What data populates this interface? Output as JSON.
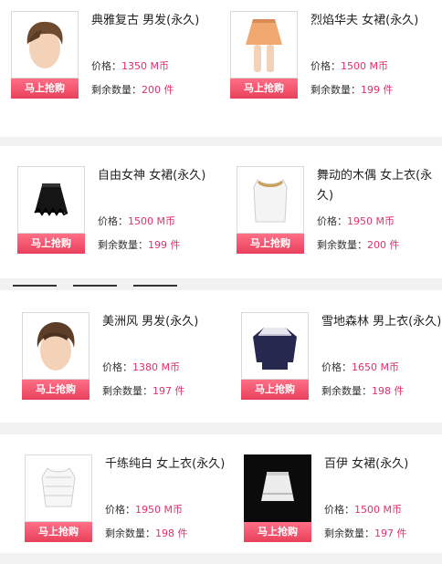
{
  "labels": {
    "buy": "马上抢购",
    "price": "价格：",
    "stock": "剩余数量：",
    "currency": " M币",
    "unit": " 件"
  },
  "items": [
    {
      "name": "典雅复古 男发(永久)",
      "price": "1350",
      "stock": "200",
      "icon": "hair-icon"
    },
    {
      "name": "烈焰华夫 女裙(永久)",
      "price": "1500",
      "stock": "199",
      "icon": "skirt-icon"
    },
    {
      "name": "自由女神 女裙(永久)",
      "price": "1500",
      "stock": "199",
      "icon": "skirt-icon"
    },
    {
      "name": "舞动的木偶 女上衣(永久)",
      "price": "1950",
      "stock": "200",
      "icon": "top-icon"
    },
    {
      "name": "美洲风 男发(永久)",
      "price": "1380",
      "stock": "197",
      "icon": "hair-icon"
    },
    {
      "name": "雪地森林 男上衣(永久)",
      "price": "1650",
      "stock": "198",
      "icon": "sweater-icon"
    },
    {
      "name": "千练纯白 女上衣(永久)",
      "price": "1950",
      "stock": "198",
      "icon": "top-icon"
    },
    {
      "name": "百伊 女裙(永久)",
      "price": "1500",
      "stock": "197",
      "icon": "skirt-icon"
    }
  ],
  "colors": {
    "accent": "#e9405c",
    "value": "#e0306f"
  }
}
